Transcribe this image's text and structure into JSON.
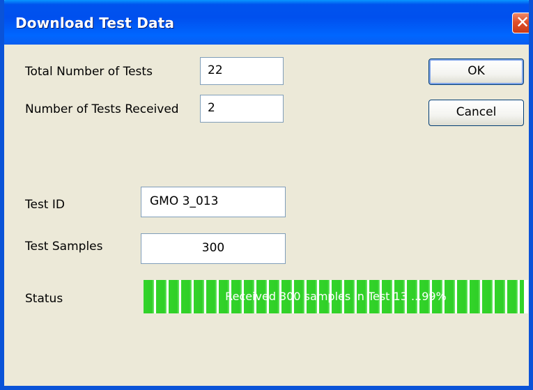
{
  "window": {
    "title": "Download Test Data",
    "close_icon": "close-icon"
  },
  "fields": {
    "total_tests_label": "Total Number of Tests",
    "total_tests_value": "22",
    "received_label": "Number of Tests Received",
    "received_value": "2",
    "test_id_label": "Test ID",
    "test_id_value": "GMO 3_013",
    "test_samples_label": "Test Samples",
    "test_samples_value": "300",
    "status_label": "Status"
  },
  "buttons": {
    "ok_label": "OK",
    "cancel_label": "Cancel"
  },
  "progress": {
    "text": "Received 300 samples in Test 13 ...99%",
    "percent": 99,
    "color": "#2fcf27"
  }
}
